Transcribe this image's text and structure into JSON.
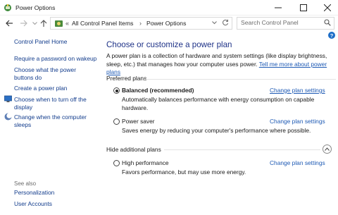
{
  "window": {
    "title": "Power Options"
  },
  "address": {
    "sep1": "«",
    "crumb1": "All Control Panel Items",
    "sep2": "›",
    "crumb2": "Power Options"
  },
  "search": {
    "placeholder": "Search Control Panel"
  },
  "sidebar": {
    "home": "Control Panel Home",
    "items": [
      {
        "label": "Require a password on wakeup"
      },
      {
        "label": "Choose what the power\nbuttons do"
      },
      {
        "label": "Create a power plan"
      },
      {
        "label": "Choose when to turn off the\ndisplay"
      },
      {
        "label": "Change when the computer\nsleeps"
      }
    ],
    "see_also": "See also",
    "see_also_items": [
      {
        "label": "Personalization"
      },
      {
        "label": "User Accounts"
      }
    ]
  },
  "main": {
    "heading": "Choose or customize a power plan",
    "intro": "A power plan is a collection of hardware and system settings (like display brightness, sleep, etc.) that manages how your computer uses power.",
    "intro_link": "Tell me more about power plans",
    "preferred_label": "Preferred plans",
    "hide_label": "Hide additional plans",
    "change_label": "Change plan settings",
    "plans": [
      {
        "name": "Balanced (recommended)",
        "description": "Automatically balances performance with energy consumption on capable hardware.",
        "selected": true
      },
      {
        "name": "Power saver",
        "description": "Saves energy by reducing your computer's performance where possible.",
        "selected": false
      },
      {
        "name": "High performance",
        "description": "Favors performance, but may use more energy.",
        "selected": false
      }
    ]
  }
}
